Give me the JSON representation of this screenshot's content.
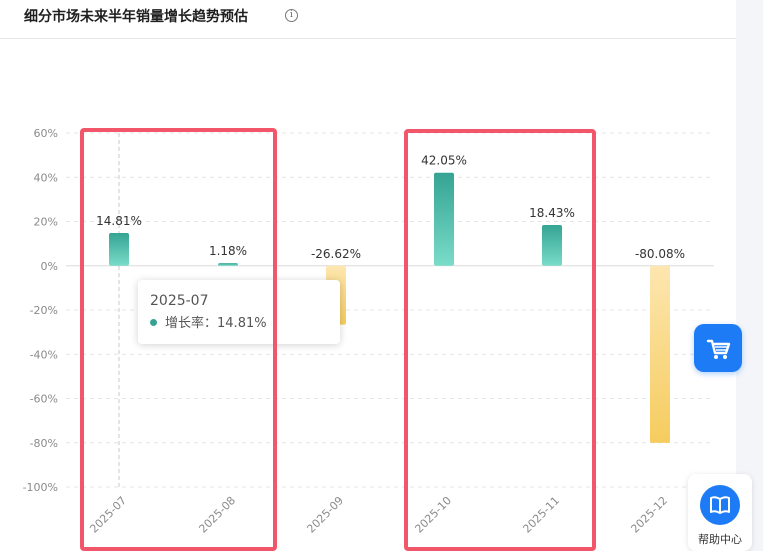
{
  "header": {
    "title": "细分市场未来半年销量增长趋势预估",
    "info_glyph": "i"
  },
  "chart_data": {
    "type": "bar",
    "categories": [
      "2025-07",
      "2025-08",
      "2025-09",
      "2025-10",
      "2025-11",
      "2025-12"
    ],
    "values": [
      14.81,
      1.18,
      -26.62,
      42.05,
      18.43,
      -80.08
    ],
    "data_labels": [
      "14.81%",
      "1.18%",
      "-26.62%",
      "42.05%",
      "18.43%",
      "-80.08%"
    ],
    "series": [
      {
        "name": "增长率",
        "values": [
          14.81,
          1.18,
          -26.62,
          42.05,
          18.43,
          -80.08
        ]
      }
    ],
    "yticks": [
      60,
      40,
      20,
      0,
      -20,
      -40,
      -60,
      -80,
      -100
    ],
    "ytick_labels": [
      "60%",
      "40%",
      "20%",
      "0%",
      "-20%",
      "-40%",
      "-60%",
      "-80%",
      "-100%"
    ],
    "ylim": [
      -100,
      60
    ],
    "grid": true,
    "colors": {
      "positive_top": "#35a393",
      "positive_bottom": "#79dcc9",
      "negative_top": "#fde6b0",
      "negative_bottom": "#f5cc5e"
    }
  },
  "tooltip": {
    "title": "2025-07",
    "label": "增长率：",
    "value": "14.81%",
    "dot_color": "#35a393"
  },
  "float_buttons": {
    "cart_icon": "cart-icon",
    "help_icon": "book-icon",
    "help_label": "帮助中心",
    "accent": "#1d7bf5"
  },
  "highlight_color": "#f2566b"
}
